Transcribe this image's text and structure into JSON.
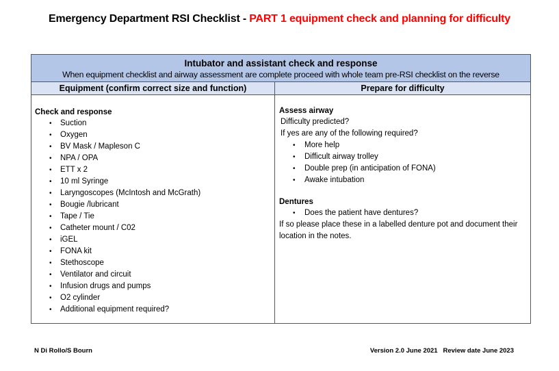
{
  "title": {
    "main": "Emergency Department RSI Checklist - ",
    "part": "PART 1 equipment check and planning for difficulty",
    "part_color": "#ff0000"
  },
  "table": {
    "band_title": "Intubator and assistant check and response",
    "band_subtitle": "When equipment checklist and airway assessment are complete proceed with whole team pre-RSI checklist on the reverse",
    "band_color": "#b4c6e7",
    "colhdr_color": "#dae3f3",
    "columns": [
      "Equipment (confirm correct size and function)",
      "Prepare for difficulty"
    ],
    "equipment": {
      "heading": "Check and response",
      "items": [
        "Suction",
        "Oxygen",
        "BV Mask / Mapleson C",
        "NPA / OPA",
        "ETT x 2",
        "10 ml Syringe",
        "Laryngoscopes (McIntosh and McGrath)",
        "Bougie /lubricant",
        "Tape / Tie",
        "Catheter mount / C02",
        "iGEL",
        "FONA kit",
        "Stethoscope",
        "Ventilator and circuit",
        "Infusion drugs and pumps",
        "O2 cylinder",
        "Additional equipment required?"
      ]
    },
    "difficulty": {
      "airway_heading": "Assess airway",
      "line1": "Difficulty predicted?",
      "line2": "If yes are any of the following required?",
      "items": [
        "More help",
        "Difficult airway trolley",
        "Double prep (in anticipation of FONA)",
        "Awake intubation"
      ],
      "dentures_heading": "Dentures",
      "dentures_items": [
        "Does the patient have dentures?"
      ],
      "dentures_note": "If so please place these in a labelled denture pot and document their location in the notes."
    }
  },
  "footer": {
    "authors": "N Di Rollo/S Bourn",
    "version": "Version 2.0 June 2021   Review date June 2023"
  },
  "bullet_glyph": "•"
}
